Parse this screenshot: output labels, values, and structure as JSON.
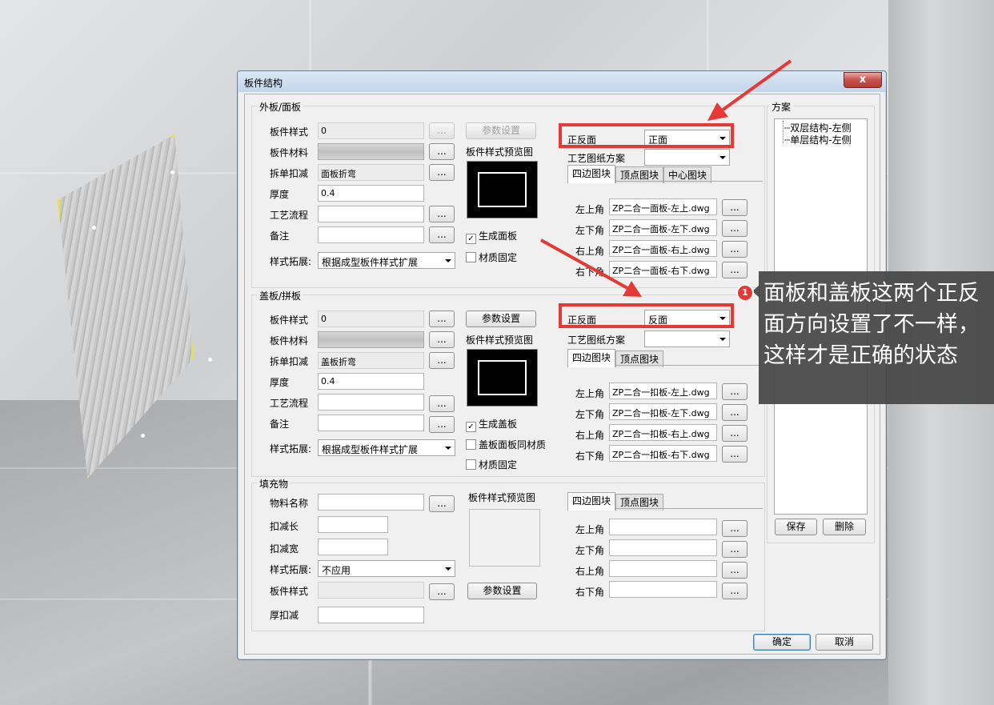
{
  "dialog": {
    "title": "板件结构",
    "close_glyph": "x"
  },
  "outer": {
    "legend": "外板/面板",
    "style_label": "板件样式",
    "style_value": "0",
    "dots": "...",
    "material_label": "板件材料",
    "deduct_label": "拆单扣减",
    "deduct_value": "面板折弯",
    "thickness_label": "厚度",
    "thickness_value": "0.4",
    "process_label": "工艺流程",
    "note_label": "备注",
    "expand_label": "样式拓展:",
    "expand_value": "根据成型板件样式扩展",
    "param_btn": "参数设置",
    "preview_label": "板件样式预览图",
    "cb_generate": "生成面板",
    "cb_generate_checked": "✓",
    "cb_fixed": "材质固定",
    "side_label": "正反面",
    "side_value": "正面",
    "drawing_label": "工艺图纸方案",
    "tabs": [
      "四边图块",
      "顶点图块",
      "中心图块"
    ],
    "corners": [
      {
        "label": "左上角",
        "value": "ZP二合一面板-左上.dwg"
      },
      {
        "label": "左下角",
        "value": "ZP二合一面板-左下.dwg"
      },
      {
        "label": "右上角",
        "value": "ZP二合一面板-右上.dwg"
      },
      {
        "label": "右下角",
        "value": "ZP二合一面板-右下.dwg"
      }
    ]
  },
  "cover": {
    "legend": "盖板/拼板",
    "style_label": "板件样式",
    "style_value": "0",
    "material_label": "板件材料",
    "deduct_label": "拆单扣减",
    "deduct_value": "盖板折弯",
    "thickness_label": "厚度",
    "thickness_value": "0.4",
    "process_label": "工艺流程",
    "note_label": "备注",
    "expand_label": "样式拓展:",
    "expand_value": "根据成型板件样式扩展",
    "param_btn": "参数设置",
    "preview_label": "板件样式预览图",
    "cb_generate": "生成盖板",
    "cb_generate_checked": "✓",
    "cb_same": "盖板面板同材质",
    "cb_fixed": "材质固定",
    "side_label": "正反面",
    "side_value": "反面",
    "drawing_label": "工艺图纸方案",
    "tabs": [
      "四边图块",
      "顶点图块"
    ],
    "corners": [
      {
        "label": "左上角",
        "value": "ZP二合一扣板-左上.dwg"
      },
      {
        "label": "左下角",
        "value": "ZP二合一扣板-左下.dwg"
      },
      {
        "label": "右上角",
        "value": "ZP二合一扣板-右上.dwg"
      },
      {
        "label": "右下角",
        "value": "ZP二合一扣板-右下.dwg"
      }
    ]
  },
  "fill": {
    "legend": "填充物",
    "name_label": "物料名称",
    "len_label": "扣减长",
    "width_label": "扣减宽",
    "expand_label": "样式拓展:",
    "expand_value": "不应用",
    "style_label": "板件样式",
    "thick_label": "厚扣减",
    "preview_label": "板件样式预览图",
    "param_btn": "参数设置",
    "tabs": [
      "四边图块",
      "顶点图块"
    ],
    "corners": [
      "左上角",
      "左下角",
      "右上角",
      "右下角"
    ]
  },
  "scheme": {
    "legend": "方案",
    "items": [
      "双层结构-左侧",
      "单层结构-左侧"
    ],
    "save": "保存",
    "delete": "删除"
  },
  "footer": {
    "ok": "确定",
    "cancel": "取消"
  },
  "annotation": {
    "badge": "1",
    "text": "面板和盖板这两个正反面方向设置了不一样，这样才是正确的状态"
  },
  "colors": {
    "highlight": "#e53935",
    "callout_bg": "#464646"
  }
}
